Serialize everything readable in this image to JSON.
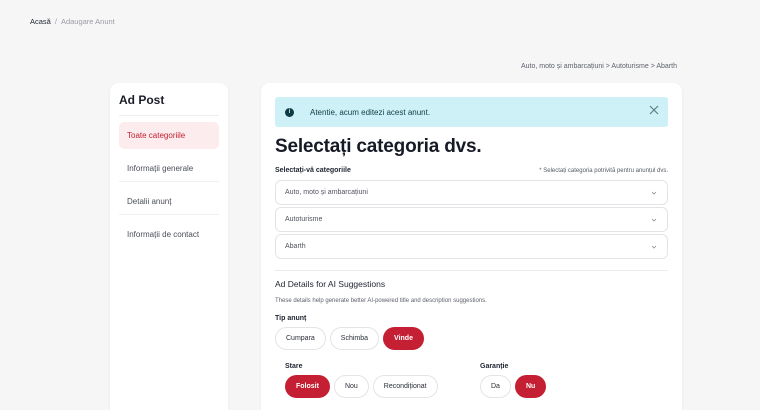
{
  "breadcrumb": {
    "home": "Acasă",
    "separator": "/",
    "current": "Adaugare Anunt"
  },
  "category_path": "Auto, moto și ambarcațiuni > Autoturisme > Abarth",
  "sidebar": {
    "title": "Ad Post",
    "items": [
      {
        "label": "Toate categoriile",
        "active": true
      },
      {
        "label": "Informații generale",
        "active": false
      },
      {
        "label": "Detalii anunț",
        "active": false
      },
      {
        "label": "Informații de contact",
        "active": false
      }
    ]
  },
  "alert": {
    "text": "Atentie, acum editezi acest anunt."
  },
  "main": {
    "title": "Selectați categoria dvs.",
    "select_label": "Selectați-vă categoriile",
    "select_hint": "* Selectați categoria potrivită pentru anunțul dvs.",
    "selects": [
      "Auto, moto și ambarcațiuni",
      "Autoturisme",
      "Abarth"
    ],
    "ai_title": "Ad Details for AI Suggestions",
    "ai_desc": "These details help generate better AI-powered title and description suggestions.",
    "tip": {
      "label": "Tip anunț",
      "options": [
        "Cumpara",
        "Schimba",
        "Vinde"
      ],
      "selected": "Vinde"
    },
    "stare": {
      "label": "Stare",
      "options": [
        "Folosit",
        "Nou",
        "Recondiționat"
      ],
      "selected": "Folosit"
    },
    "garantie": {
      "label": "Garanție",
      "options": [
        "Da",
        "Nu"
      ],
      "selected": "Nu"
    }
  },
  "colors": {
    "accent": "#c51f33",
    "alert_bg": "#cdf1f6",
    "active_bg": "#fcecee"
  }
}
